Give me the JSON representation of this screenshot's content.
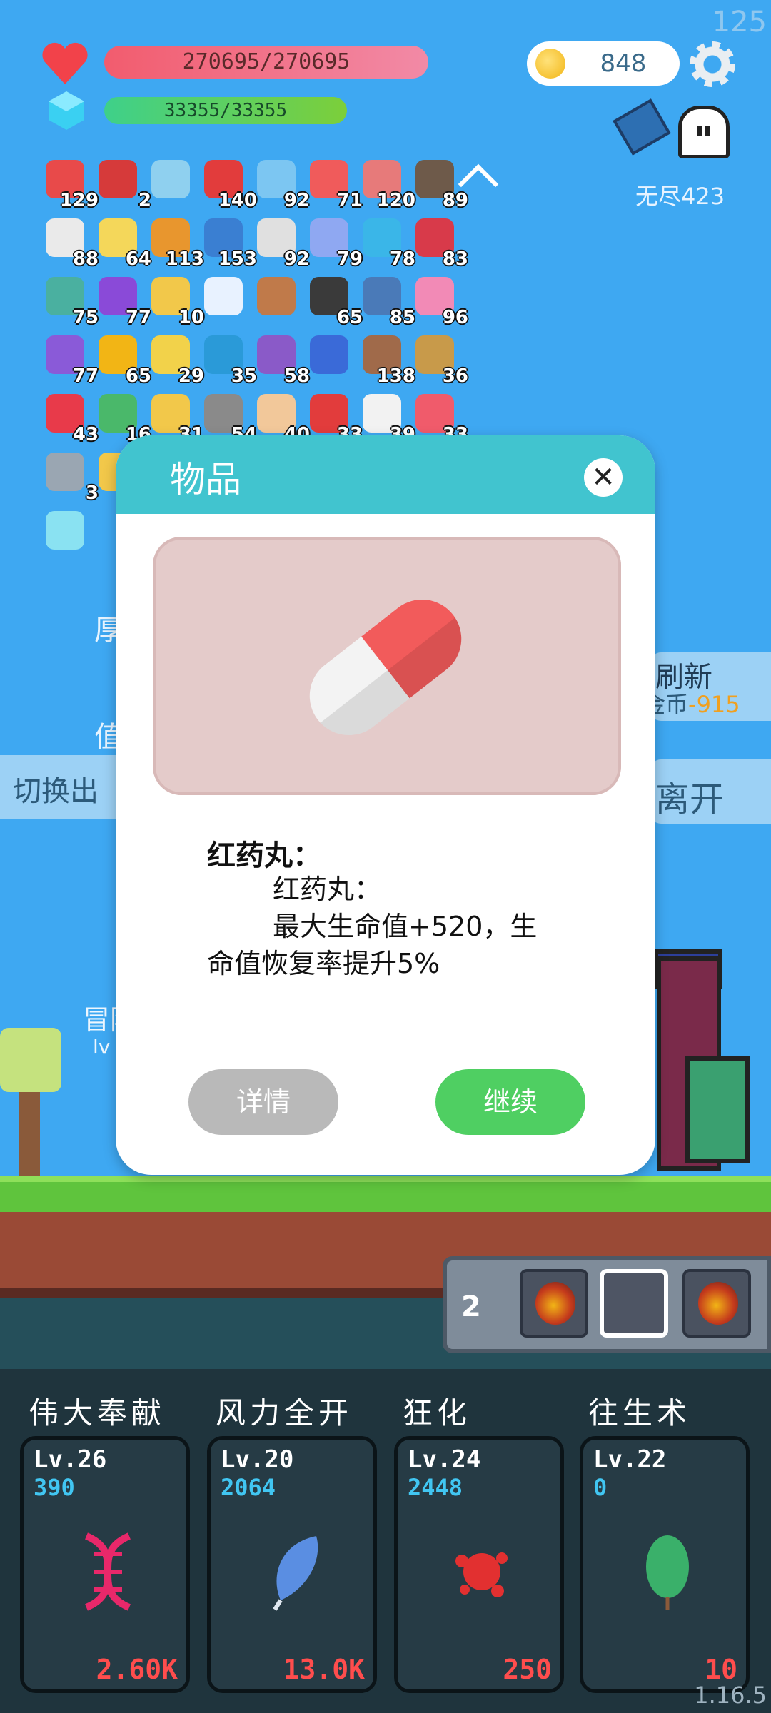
{
  "hud": {
    "fps": "125",
    "hp": "270695/270695",
    "mp": "33355/33355",
    "gold": "848",
    "mode": "无尽423",
    "version": "1.16.5"
  },
  "inventory": [
    {
      "icon": "boot-icon",
      "count": "129",
      "color": "#e84a4a"
    },
    {
      "icon": "magnet-icon",
      "count": "2",
      "color": "#d63a3a"
    },
    {
      "icon": "magnifier-icon",
      "count": "",
      "color": "#8fd0ef"
    },
    {
      "icon": "apple-icon",
      "count": "140",
      "color": "#e23c3c"
    },
    {
      "icon": "potion-blue-icon",
      "count": "92",
      "color": "#7cc6f2"
    },
    {
      "icon": "pill-red-icon",
      "count": "71",
      "color": "#f05b5b"
    },
    {
      "icon": "jar-icon",
      "count": "120",
      "color": "#e77a7a"
    },
    {
      "icon": "coconut-icon",
      "count": "89",
      "color": "#6e5a4a"
    },
    {
      "icon": "envelope-icon",
      "count": "88",
      "color": "#eaeaea"
    },
    {
      "icon": "halo-icon",
      "count": "64",
      "color": "#f4d75a"
    },
    {
      "icon": "book-icon",
      "count": "113",
      "color": "#e8962e"
    },
    {
      "icon": "star-card-icon",
      "count": "153",
      "color": "#3a7fd2"
    },
    {
      "icon": "bulb-icon",
      "count": "92",
      "color": "#e0e0e0"
    },
    {
      "icon": "pill-blue-icon",
      "count": "79",
      "color": "#8fa8f2"
    },
    {
      "icon": "chat-bubble-icon",
      "count": "78",
      "color": "#3ab6e8"
    },
    {
      "icon": "shield-red-icon",
      "count": "83",
      "color": "#d83a4a"
    },
    {
      "icon": "ring-icon",
      "count": "75",
      "color": "#4ab0a0"
    },
    {
      "icon": "orb-icon",
      "count": "77",
      "color": "#8a4ad8"
    },
    {
      "icon": "lamp-icon",
      "count": "10",
      "color": "#f2c84a"
    },
    {
      "icon": "wing-icon",
      "count": "",
      "color": "#e8f2ff"
    },
    {
      "icon": "flask-icon",
      "count": "",
      "color": "#c07a4a"
    },
    {
      "icon": "cauldron-icon",
      "count": "65",
      "color": "#3a3a3a"
    },
    {
      "icon": "shield-blue-icon",
      "count": "85",
      "color": "#4a7ab8"
    },
    {
      "icon": "spray-icon",
      "count": "96",
      "color": "#f28ab6"
    },
    {
      "icon": "box-icon",
      "count": "77",
      "color": "#8a5ad8"
    },
    {
      "icon": "sunflower-icon",
      "count": "65",
      "color": "#f2b515"
    },
    {
      "icon": "gem-ring-icon",
      "count": "29",
      "color": "#f2d24a"
    },
    {
      "icon": "crystal-icon",
      "count": "35",
      "color": "#2a9ad8"
    },
    {
      "icon": "shield-star-icon",
      "count": "58",
      "color": "#8a5ac8"
    },
    {
      "icon": "cards-icon",
      "count": "",
      "color": "#3a6ad8"
    },
    {
      "icon": "donut-icon",
      "count": "138",
      "color": "#a06a4a"
    },
    {
      "icon": "necklace-icon",
      "count": "36",
      "color": "#c89a4a"
    },
    {
      "icon": "heart-plus-icon",
      "count": "43",
      "color": "#e83a4a"
    },
    {
      "icon": "money-heart-icon",
      "count": "16",
      "color": "#4ab86a"
    },
    {
      "icon": "wand-icon",
      "count": "31",
      "color": "#f2c84a"
    },
    {
      "icon": "tombstone-icon",
      "count": "54",
      "color": "#8a8a8a"
    },
    {
      "icon": "hand-icon",
      "count": "40",
      "color": "#f2c89a"
    },
    {
      "icon": "strawberry-icon",
      "count": "33",
      "color": "#e23c3c"
    },
    {
      "icon": "cloud-icon",
      "count": "39",
      "color": "#f2f2f2"
    },
    {
      "icon": "heart-icon",
      "count": "33",
      "color": "#f05b6b"
    },
    {
      "icon": "compass-icon",
      "count": "3",
      "color": "#9aa6b2"
    },
    {
      "icon": "crown-icon",
      "count": "",
      "color": "#f2c84a"
    },
    {
      "icon": "lightning-tile-icon",
      "count": "",
      "color": "#8ae2f2"
    }
  ],
  "background_panel": {
    "switch_label": "切换出",
    "refresh_label": "刷新",
    "refresh_cost_prefix": "金币",
    "refresh_cost_value": "-915",
    "leave_label": "离开",
    "left_char1": "厚",
    "left_char2": "值",
    "adventurer": "冒险",
    "level_prefix": "lv"
  },
  "dialog": {
    "title": "物品",
    "item_name": "红药丸：",
    "desc_line1": "红药丸：",
    "desc_line2": "最大生命值+520，生",
    "desc_line3": "命值恢复率提升5%",
    "detail_button": "详情",
    "continue_button": "继续"
  },
  "potion_belt": {
    "count": "2",
    "slots": [
      "potion",
      "empty",
      "potion"
    ]
  },
  "skills": [
    {
      "name": "伟大奉献",
      "level": "Lv.26",
      "points": "390",
      "cost": "2.60K",
      "icon": "dna-icon",
      "color": "#e8286a"
    },
    {
      "name": "风力全开",
      "level": "Lv.20",
      "points": "2064",
      "cost": "13.0K",
      "icon": "feather-icon",
      "color": "#5a8ee2"
    },
    {
      "name": "狂化",
      "level": "Lv.24",
      "points": "2448",
      "cost": "250",
      "icon": "splat-icon",
      "color": "#e23030"
    },
    {
      "name": "往生术",
      "level": "Lv.22",
      "points": "0",
      "cost": "10",
      "icon": "leaf-icon",
      "color": "#3ab06a"
    }
  ],
  "colors": {
    "sky": "#3ea8f2",
    "dialog_header": "#41c4cf",
    "continue": "#4fcf62",
    "detail": "#b9b9b9"
  }
}
